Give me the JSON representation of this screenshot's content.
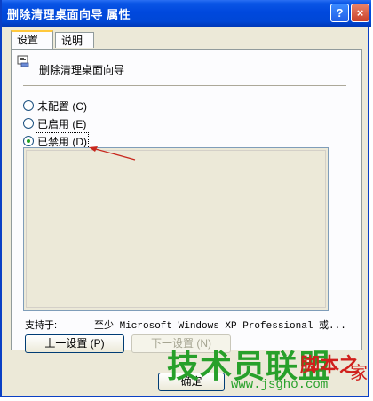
{
  "window": {
    "title": "删除清理桌面向导 属性",
    "help_glyph": "?",
    "close_glyph": "×"
  },
  "tabs": [
    {
      "label": "设置",
      "active": true
    },
    {
      "label": "说明",
      "active": false
    }
  ],
  "policy": {
    "title": "删除清理桌面向导",
    "icon": "policy-setting-icon"
  },
  "options": [
    {
      "label": "未配置 (C)",
      "checked": false
    },
    {
      "label": "已启用 (E)",
      "checked": false
    },
    {
      "label": "已禁用 (D)",
      "checked": true
    }
  ],
  "supported": {
    "label": "支持于:",
    "value": "至少 Microsoft Windows XP Professional 或..."
  },
  "buttons": {
    "prev": "上一设置 (P)",
    "next": "下一设置 (N)",
    "ok": "确定"
  },
  "watermark": {
    "main": "技术员联盟",
    "sub": "www.jsgho.com",
    "red": "脚本之",
    "home": "家"
  },
  "colors": {
    "titlebar": "#0048dd",
    "accent_red": "#d0201c",
    "watermark_green": "#27a02a"
  }
}
